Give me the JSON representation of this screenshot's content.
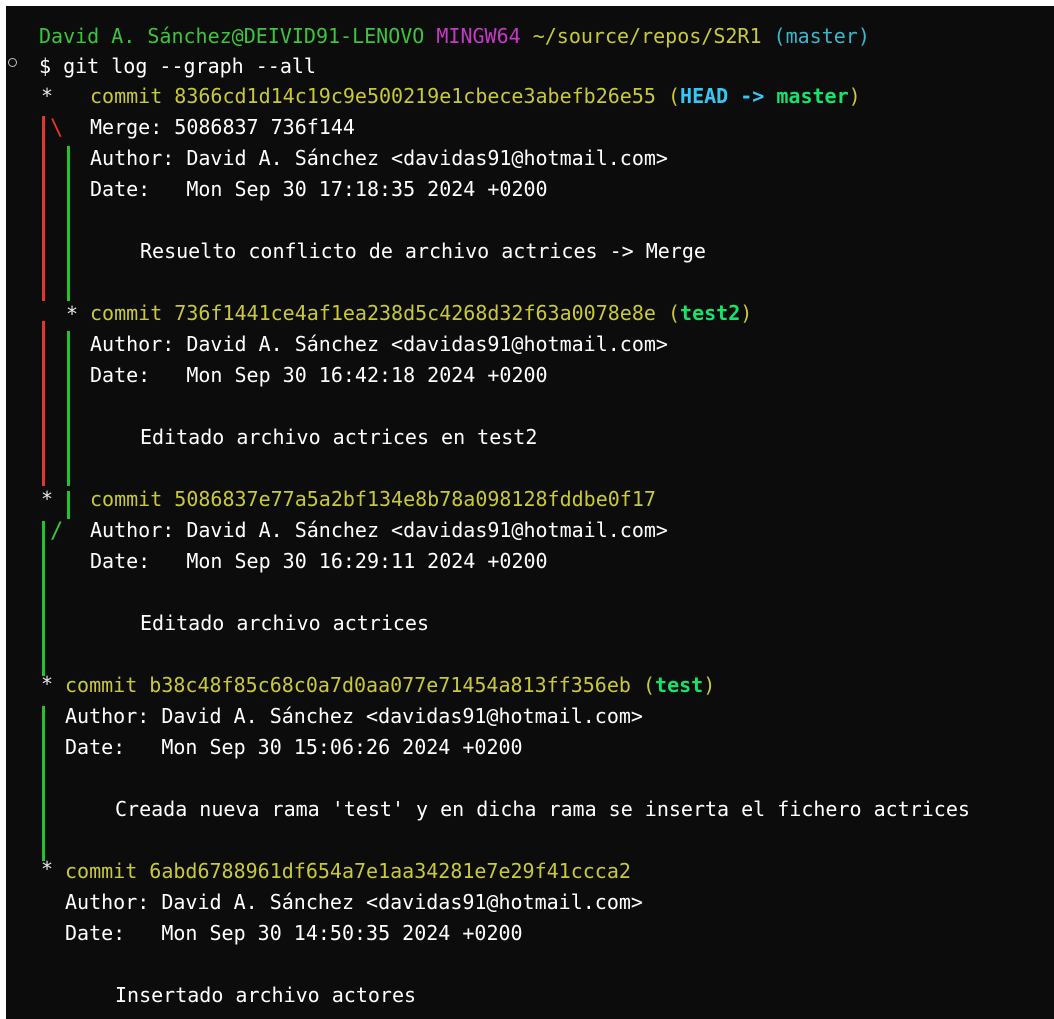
{
  "prompt": {
    "user_host": "David A. Sánchez@DEIVID91-LENOVO",
    "system": "MINGW64",
    "path": "~/source/repos/S2R1",
    "branch": "(master)",
    "symbol": "$",
    "command": "git log --graph --all"
  },
  "commits": [
    {
      "commit_line": "commit 8366cd1d14c19c9e500219e1cbece3abefb26e55",
      "ref_open": "(",
      "ref_head": "HEAD -> ",
      "ref_branch": "master",
      "ref_close": ")",
      "merge": "Merge: 5086837 736f144",
      "author": "Author: David A. Sánchez <davidas91@hotmail.com>",
      "date_label": "Date:",
      "date_value": "Mon Sep 30 17:18:35 2024 +0200",
      "message": "Resuelto conflicto de archivo actrices -> Merge"
    },
    {
      "commit_line": "commit 736f1441ce4af1ea238d5c4268d32f63a0078e8e",
      "ref_open": "(",
      "ref_branch": "test2",
      "ref_close": ")",
      "author": "Author: David A. Sánchez <davidas91@hotmail.com>",
      "date_label": "Date:",
      "date_value": "Mon Sep 30 16:42:18 2024 +0200",
      "message": "Editado archivo actrices en test2"
    },
    {
      "commit_line": "commit 5086837e77a5a2bf134e8b78a098128fddbe0f17",
      "author": "Author: David A. Sánchez <davidas91@hotmail.com>",
      "date_label": "Date:",
      "date_value": "Mon Sep 30 16:29:11 2024 +0200",
      "message": "Editado archivo actrices"
    },
    {
      "commit_line": "commit b38c48f85c68c0a7d0aa077e71454a813ff356eb",
      "ref_open": "(",
      "ref_branch": "test",
      "ref_close": ")",
      "author": "Author: David A. Sánchez <davidas91@hotmail.com>",
      "date_label": "Date:",
      "date_value": "Mon Sep 30 15:06:26 2024 +0200",
      "message": "Creada nueva rama 'test' y en dicha rama se inserta el fichero actrices"
    },
    {
      "commit_line": "commit 6abd6788961df654a7e1aa34281e7e29f41ccca2",
      "author": "Author: David A. Sánchez <davidas91@hotmail.com>",
      "date_label": "Date:",
      "date_value": "Mon Sep 30 14:50:35 2024 +0200",
      "message": "Insertado archivo actores"
    }
  ],
  "graph_glyphs": {
    "star": "*",
    "merge_out": "\\",
    "merge_in": "/"
  },
  "colors": {
    "background": "#0c0c0c",
    "prompt_user": "#3dc43d",
    "prompt_system": "#c837c8",
    "prompt_path": "#c8c83a",
    "prompt_branch": "#3ab7c9",
    "commit_hash": "#c8c83a",
    "head_ref": "#35c8f5",
    "branch_ref": "#16e36c",
    "graph_red": "#e0382e",
    "graph_green": "#22c32c"
  }
}
